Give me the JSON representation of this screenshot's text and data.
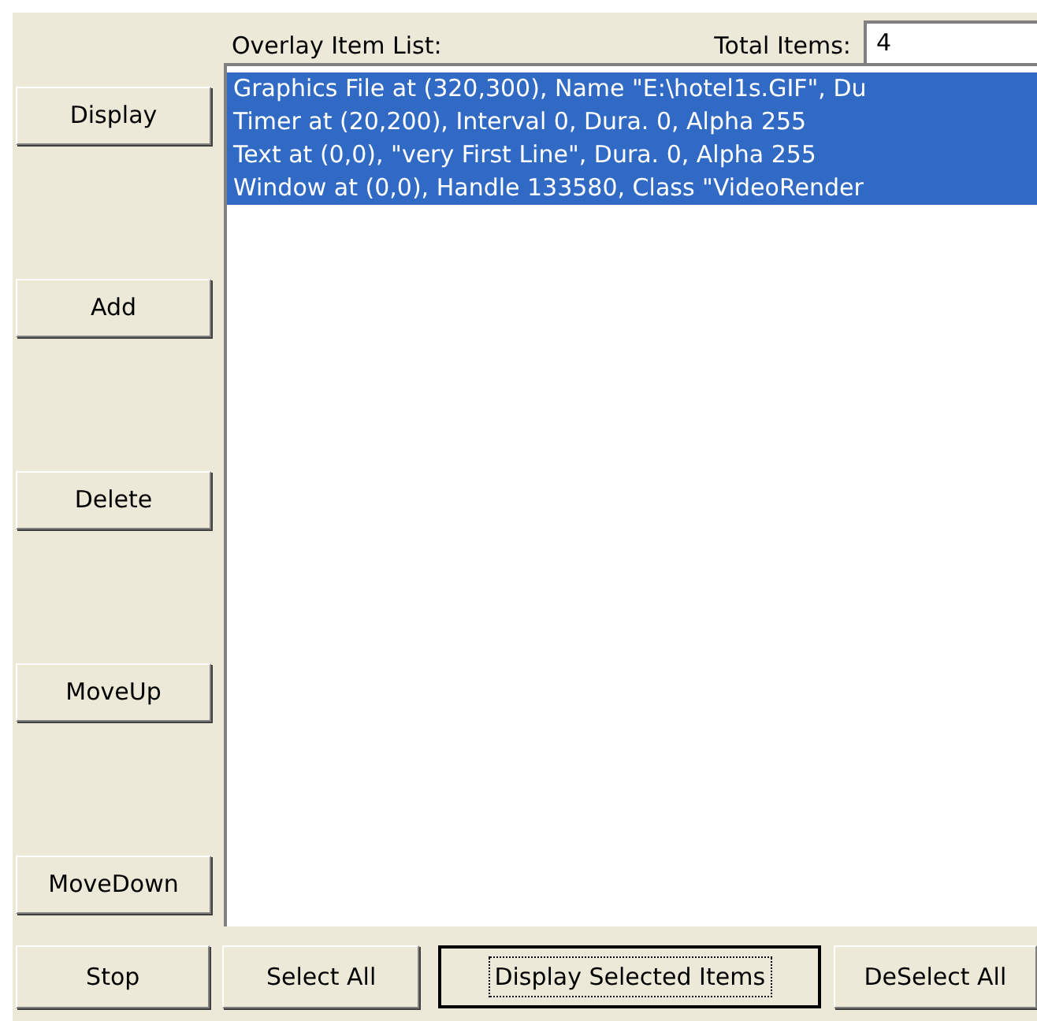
{
  "header": {
    "list_label": "Overlay Item List:",
    "total_label": "Total Items:",
    "total_value": "4"
  },
  "side_buttons": [
    "Display",
    "Add",
    "Delete",
    "MoveUp",
    "MoveDown"
  ],
  "list_items": [
    {
      "text": "Graphics File at (320,300), Name \"E:\\hotel1s.GIF\", Du",
      "selected": true
    },
    {
      "text": "Timer at (20,200), Interval 0, Dura. 0, Alpha 255",
      "selected": true
    },
    {
      "text": "Text at (0,0), \"very First Line\", Dura. 0, Alpha 255",
      "selected": true
    },
    {
      "text": "Window at (0,0), Handle 133580, Class \"VideoRender",
      "selected": true
    }
  ],
  "bottom_buttons": [
    {
      "label": "Stop",
      "default": false
    },
    {
      "label": "Select All",
      "default": false
    },
    {
      "label": "Display Selected Items",
      "default": true
    },
    {
      "label": "DeSelect All",
      "default": false
    }
  ]
}
